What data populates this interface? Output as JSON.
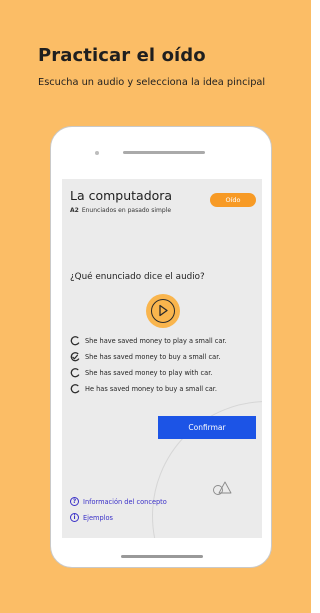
{
  "header": {
    "title": "Practicar el oído",
    "subtitle": "Escucha un audio y selecciona la idea pincipal"
  },
  "lesson": {
    "title": "La computadora",
    "level": "A2",
    "topic": "Enunciados en pasado simple",
    "badge": "Oído"
  },
  "question": "¿Qué enunciado dice el audio?",
  "play_icon": "play-icon",
  "options": [
    {
      "label": "She have saved money to play a small car.",
      "selected": false
    },
    {
      "label": "She has saved money to buy a small car.",
      "selected": true
    },
    {
      "label": "She has saved money to play with car.",
      "selected": false
    },
    {
      "label": "He has saved money to buy a small car.",
      "selected": false
    }
  ],
  "confirm_label": "Confirmar",
  "links": {
    "concept": "Información del concepto",
    "examples": "Ejemplos"
  },
  "colors": {
    "background": "#fbbd66",
    "accent_orange": "#f79a25",
    "primary_blue": "#1c54e6",
    "link_purple": "#3a30c8"
  }
}
